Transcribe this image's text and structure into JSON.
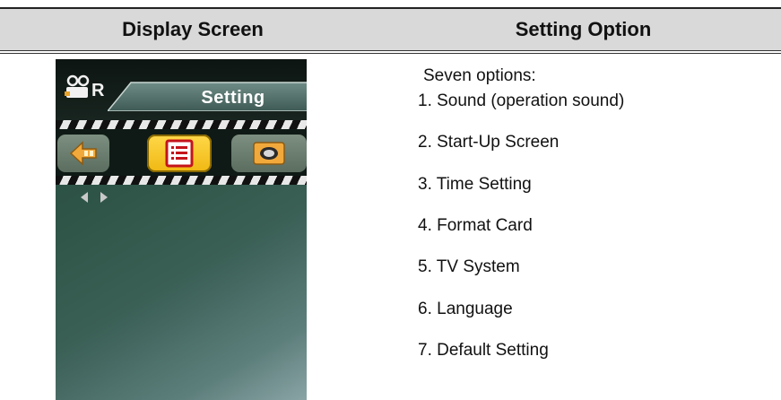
{
  "table": {
    "header_left": "Display Screen",
    "header_right": "Setting Option"
  },
  "screen": {
    "mode_letter": "R",
    "tab_label": "Setting",
    "icons": [
      "back-arrow-icon",
      "settings-list-icon",
      "image-frame-icon"
    ],
    "selected_icon": "settings-list-icon",
    "colors": {
      "selected": "#f5c518",
      "background": "#2f5548"
    }
  },
  "options": {
    "intro": "Seven options:",
    "items": [
      "1. Sound (operation sound)",
      "2. Start-Up Screen",
      "3. Time Setting",
      "4. Format Card",
      "5. TV System",
      "6. Language",
      "7. Default Setting"
    ]
  }
}
